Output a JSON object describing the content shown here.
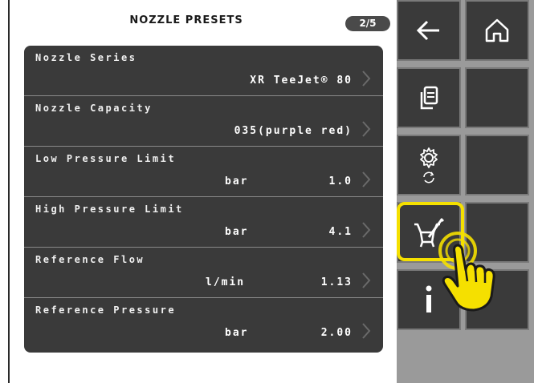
{
  "header": {
    "title": "NOZZLE PRESETS",
    "page_indicator": "2/5"
  },
  "settings": [
    {
      "label": "Nozzle Series",
      "unit": "",
      "value": "XR TeeJet® 80"
    },
    {
      "label": "Nozzle Capacity",
      "unit": "",
      "value": "035(purple red)"
    },
    {
      "label": "Low Pressure Limit",
      "unit": "bar",
      "value": "1.0"
    },
    {
      "label": "High Pressure Limit",
      "unit": "bar",
      "value": "4.1"
    },
    {
      "label": "Reference Flow",
      "unit": "l/min",
      "value": "1.13"
    },
    {
      "label": "Reference Pressure",
      "unit": "bar",
      "value": "2.00"
    }
  ],
  "nav": {
    "buttons": [
      {
        "icon": "back-arrow-icon"
      },
      {
        "icon": "home-icon"
      },
      {
        "icon": "copy-icon"
      },
      {
        "icon": "settings-sync-icon"
      },
      {
        "icon": "nozzle-edit-icon",
        "highlighted": true
      },
      {
        "icon": "info-icon"
      }
    ]
  },
  "colors": {
    "panel_bg": "#3a3a3a",
    "nav_bg": "#9a9a9a",
    "highlight": "#f5e000",
    "text": "#ffffff"
  }
}
